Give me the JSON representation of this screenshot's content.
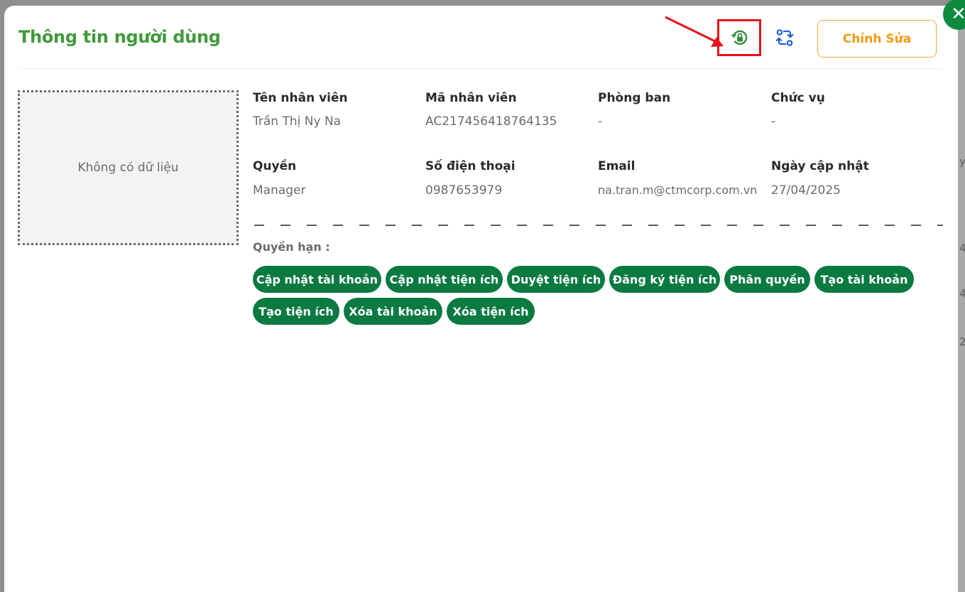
{
  "modal": {
    "title": "Thông tin người dùng",
    "edit_label": "Chỉnh Sửa",
    "close_glyph": "✕",
    "accent_color": "#0a7a41",
    "title_color": "#3f9a3b",
    "highlight_color": "#e8101a"
  },
  "background": {
    "snippets": [
      "y",
      "4",
      "4",
      "2,"
    ]
  },
  "avatar": {
    "empty_text": "Không có dữ liệu"
  },
  "fields": {
    "name": {
      "label": "Tên nhân viên",
      "value": "Trần Thị Ny Na"
    },
    "code": {
      "label": "Mã nhân viên",
      "value": "AC217456418764135"
    },
    "department": {
      "label": "Phòng ban",
      "value": "-"
    },
    "position": {
      "label": "Chức vụ",
      "value": "-"
    },
    "role": {
      "label": "Quyền",
      "value": "Manager"
    },
    "phone": {
      "label": "Số điện thoại",
      "value": "0987653979"
    },
    "email": {
      "label": "Email",
      "value": "na.tran.m@ctmcorp.com.vn"
    },
    "updated": {
      "label": "Ngày cập nhật",
      "value": "27/04/2025"
    }
  },
  "permissions": {
    "title": "Quyền hạn :",
    "items": [
      "Cập nhật tài khoản",
      "Cập nhật tiện ích",
      "Duyệt tiện ích",
      "Đăng ký tiện ích",
      "Phân quyền",
      "Tạo tài khoản",
      "Tạo tiện ích",
      "Xóa tài khoản",
      "Xóa tiện ích"
    ]
  },
  "icons": {
    "lock_reset": "lock-reset-icon",
    "sync": "sync-icon",
    "close": "close-icon",
    "arrow": "annotation-arrow"
  }
}
